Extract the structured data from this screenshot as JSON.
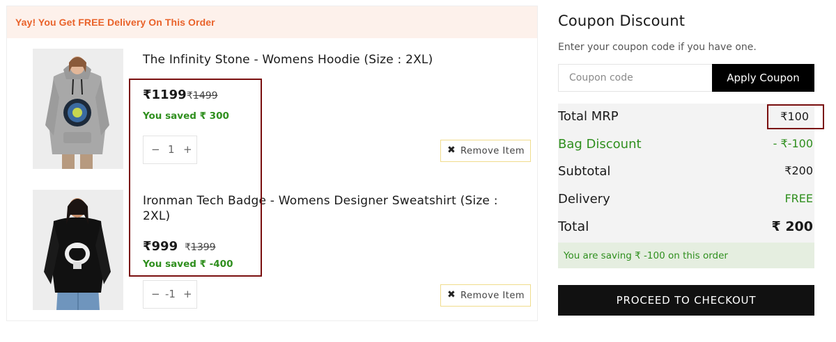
{
  "banner": {
    "text": "Yay! You Get FREE Delivery On This Order"
  },
  "items": [
    {
      "name": "The Infinity Stone - Womens Hoodie (Size : 2XL)",
      "price": "₹1199",
      "mrp_symbol": "₹",
      "mrp": "1499",
      "saved": "You saved ₹ 300",
      "qty": {
        "minus": "−",
        "value": "1",
        "plus": "+"
      },
      "remove_icon": "close-icon",
      "remove_label": "Remove Item"
    },
    {
      "name": "Ironman Tech Badge - Womens Designer Sweatshirt (Size : 2XL)",
      "price": "₹999",
      "mrp_symbol": "₹",
      "mrp": "1399",
      "saved": "You saved ₹ -400",
      "qty": {
        "minus": "−",
        "value": "-1",
        "plus": "+"
      },
      "remove_icon": "close-icon",
      "remove_label": "Remove Item"
    }
  ],
  "summary": {
    "title": "Coupon Discount",
    "subtitle": "Enter your coupon code if you have one.",
    "coupon_placeholder": "Coupon code",
    "apply_label": "Apply Coupon",
    "rows": [
      {
        "label": "Total MRP",
        "value": "₹100"
      },
      {
        "label": "Bag Discount",
        "value": "- ₹-100"
      },
      {
        "label": "Subtotal",
        "value": "₹200"
      },
      {
        "label": "Delivery",
        "value": "FREE"
      },
      {
        "label": "Total",
        "value": "₹ 200"
      }
    ],
    "saving_text": "You are saving ₹ -100 on this order",
    "checkout_label": "PROCEED TO CHECKOUT"
  },
  "colors": {
    "banner_bg": "#fdf1eb",
    "banner_text": "#e9622a",
    "green": "#2f8f1e",
    "highlight_border": "#7a0f0f",
    "remove_border": "#f0dc8c",
    "button_dark": "#111111"
  }
}
